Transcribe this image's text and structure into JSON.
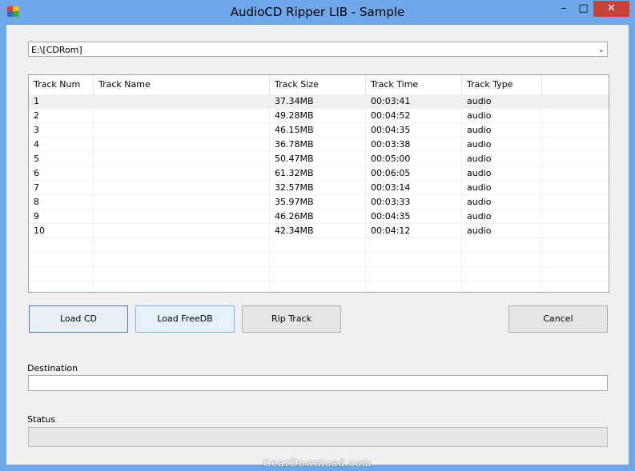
{
  "window": {
    "title": "AudioCD Ripper LIB - Sample",
    "minimize": "–",
    "maximize": "□",
    "close": "✕"
  },
  "drive": {
    "value": "E:\\[CDRom]",
    "arrow": "⌄"
  },
  "table": {
    "columns": [
      "Track Num",
      "Track Name",
      "Track Size",
      "Track Time",
      "Track Type",
      ""
    ],
    "rows": [
      {
        "num": "1",
        "name": "",
        "size": "37.34MB",
        "time": "00:03:41",
        "type": "audio"
      },
      {
        "num": "2",
        "name": "",
        "size": "49.28MB",
        "time": "00:04:52",
        "type": "audio"
      },
      {
        "num": "3",
        "name": "",
        "size": "46.15MB",
        "time": "00:04:35",
        "type": "audio"
      },
      {
        "num": "4",
        "name": "",
        "size": "36.78MB",
        "time": "00:03:38",
        "type": "audio"
      },
      {
        "num": "5",
        "name": "",
        "size": "50.47MB",
        "time": "00:05:00",
        "type": "audio"
      },
      {
        "num": "6",
        "name": "",
        "size": "61.32MB",
        "time": "00:06:05",
        "type": "audio"
      },
      {
        "num": "7",
        "name": "",
        "size": "32.57MB",
        "time": "00:03:14",
        "type": "audio"
      },
      {
        "num": "8",
        "name": "",
        "size": "35.97MB",
        "time": "00:03:33",
        "type": "audio"
      },
      {
        "num": "9",
        "name": "",
        "size": "46.26MB",
        "time": "00:04:35",
        "type": "audio"
      },
      {
        "num": "10",
        "name": "",
        "size": "42.34MB",
        "time": "00:04:12",
        "type": "audio"
      }
    ]
  },
  "buttons": {
    "load_cd": "Load CD",
    "load_freedb": "Load FreeDB",
    "rip_track": "Rip Track",
    "cancel": "Cancel"
  },
  "labels": {
    "destination": "Destination",
    "status": "Status"
  },
  "destination_value": "",
  "watermark": "GearDownload.com",
  "colors": {
    "titlebar": "#6ea8e8",
    "close_button": "#c7433a",
    "selected_row": "#f0f0f0"
  }
}
